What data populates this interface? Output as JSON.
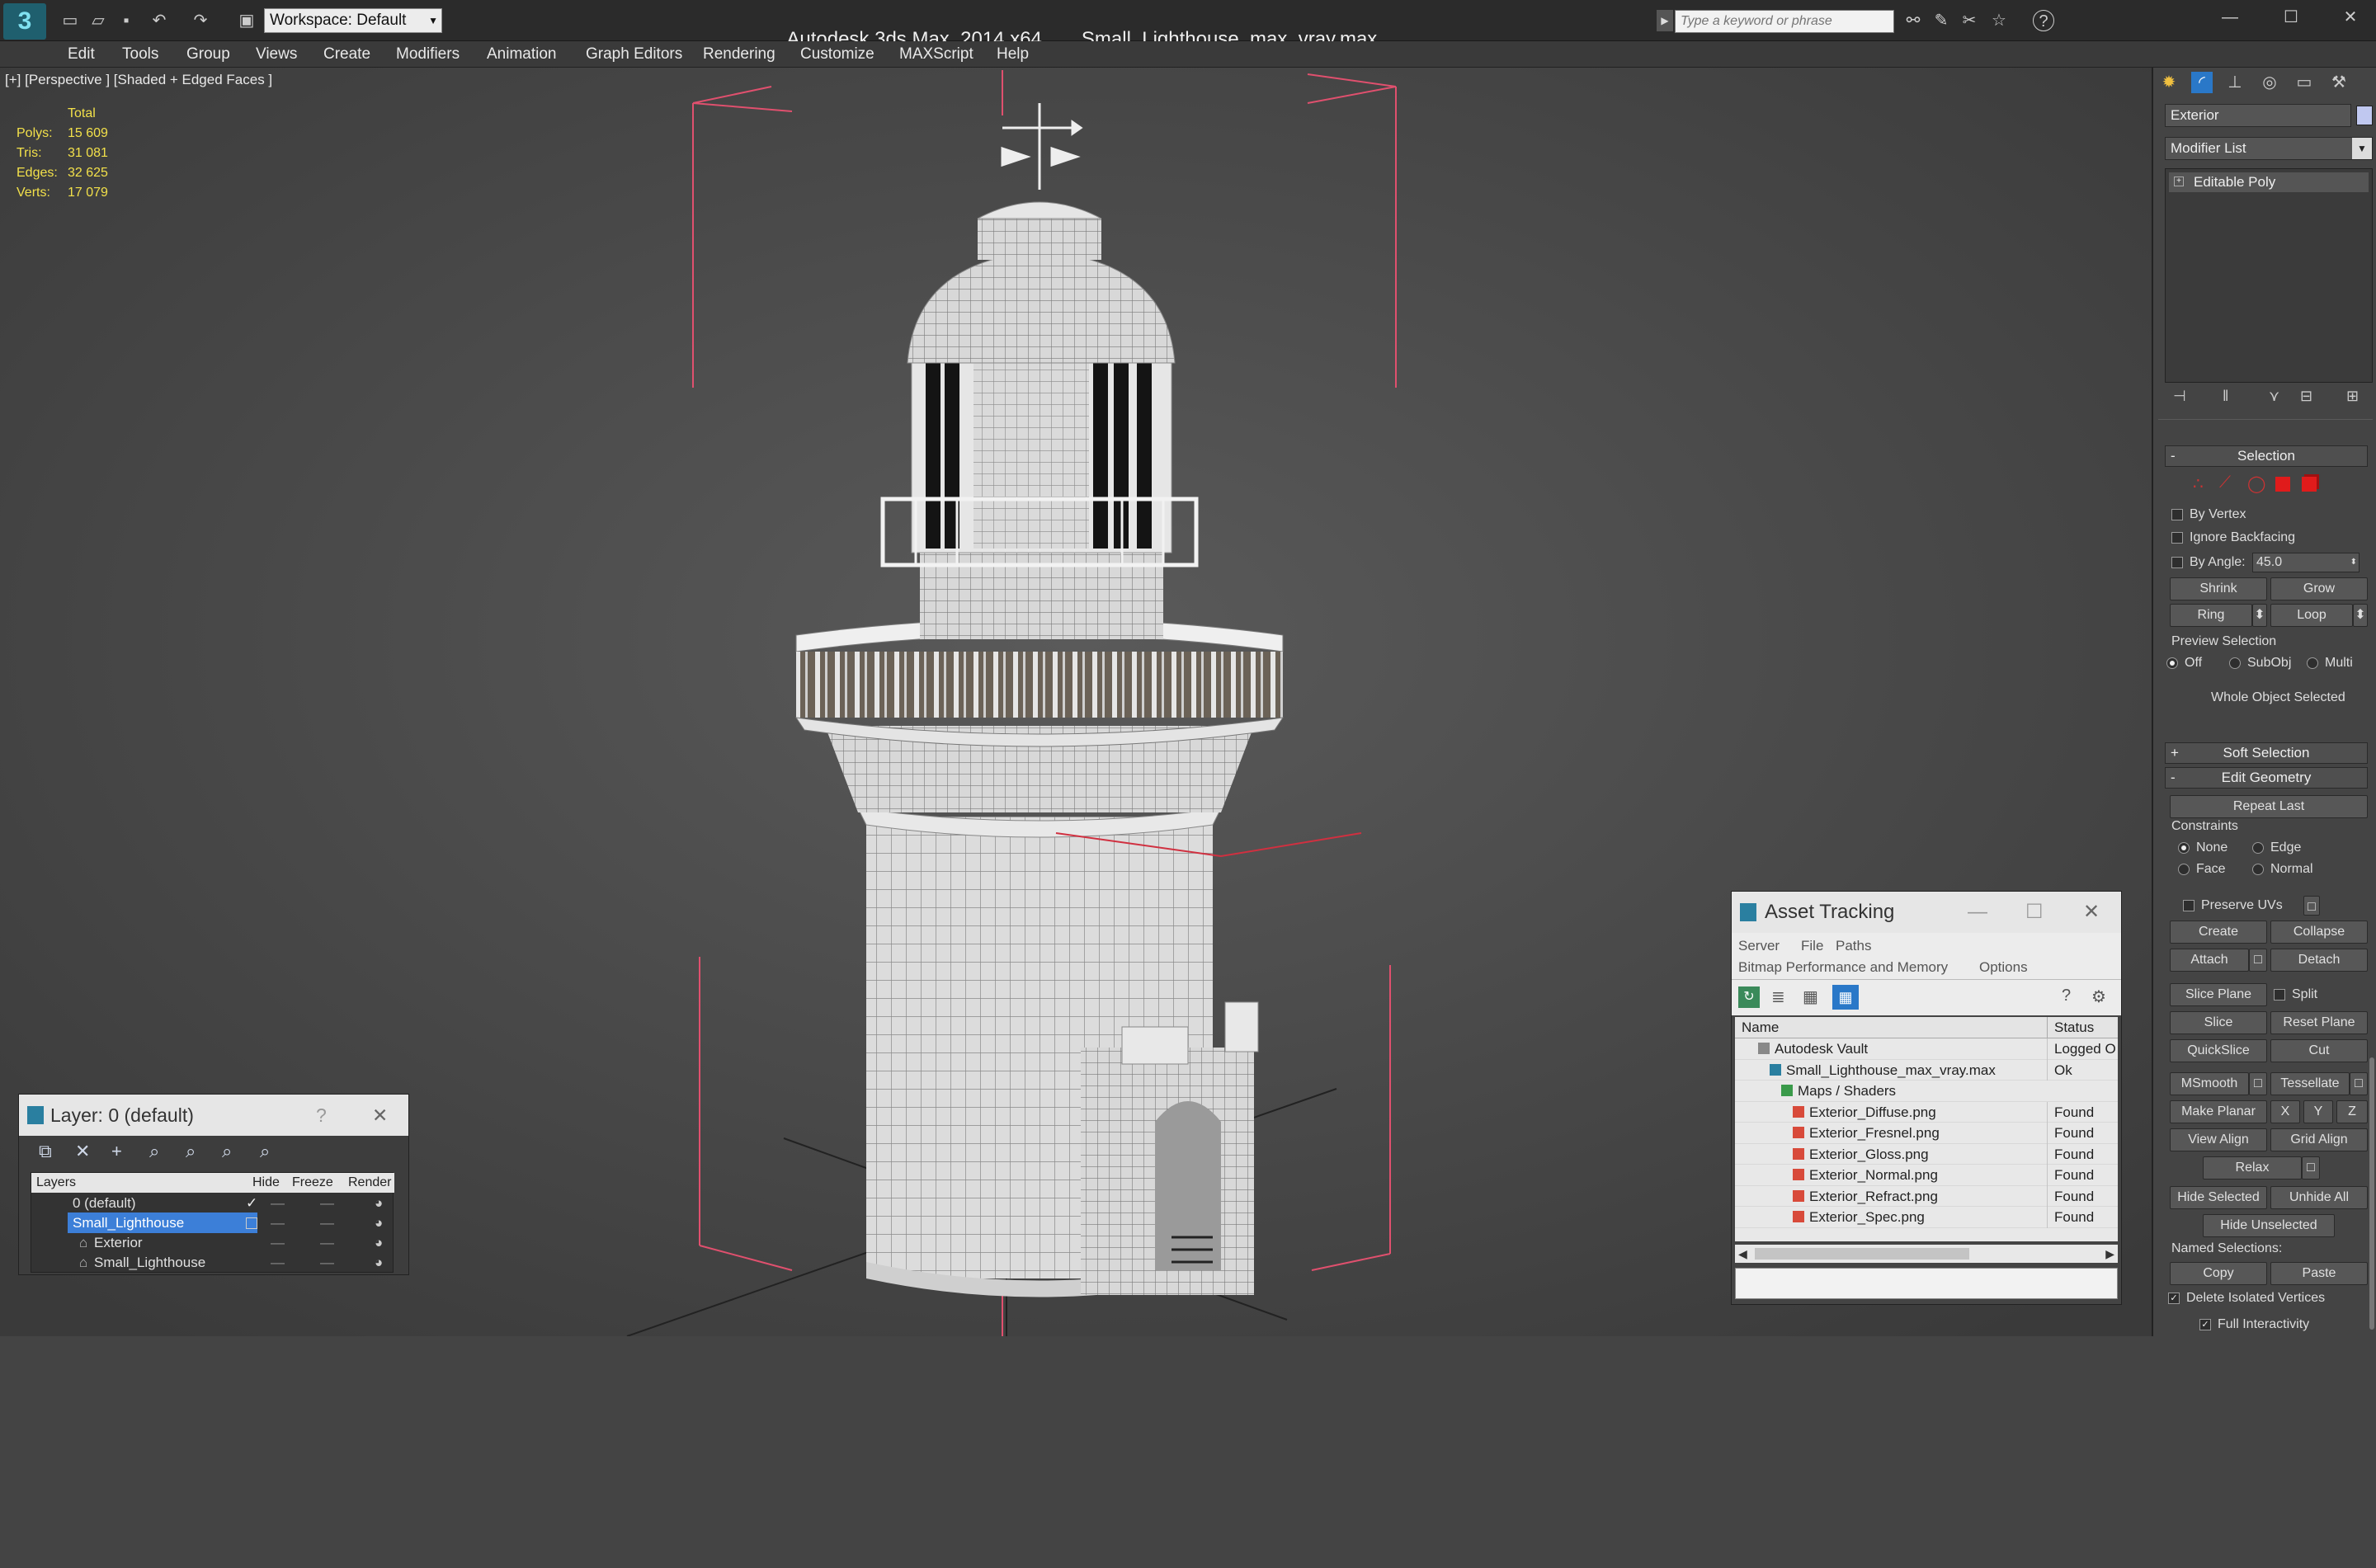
{
  "app": {
    "title": "Autodesk 3ds Max  2014 x64",
    "file": "Small_Lighthouse_max_vray.max",
    "workspace": "Workspace: Default",
    "search_placeholder": "Type a keyword or phrase"
  },
  "menu": [
    "Edit",
    "Tools",
    "Group",
    "Views",
    "Create",
    "Modifiers",
    "Animation",
    "Graph Editors",
    "Rendering",
    "Customize",
    "MAXScript",
    "Help"
  ],
  "viewport": {
    "label": "[+] [Perspective ] [Shaded + Edged Faces ]",
    "stats": {
      "total_label": "Total",
      "rows": [
        {
          "k": "Polys:",
          "v": "15 609"
        },
        {
          "k": "Tris:",
          "v": "31 081"
        },
        {
          "k": "Edges:",
          "v": "32 625"
        },
        {
          "k": "Verts:",
          "v": "17 079"
        }
      ]
    }
  },
  "layer_panel": {
    "title": "Layer: 0 (default)",
    "help": "?",
    "columns": [
      "Layers",
      "Hide",
      "Freeze",
      "Render"
    ],
    "rows": [
      {
        "name": "0 (default)",
        "indent": 1,
        "selected": false
      },
      {
        "name": "Small_Lighthouse",
        "indent": 1,
        "selected": true
      },
      {
        "name": "Exterior",
        "indent": 2,
        "selected": false
      },
      {
        "name": "Small_Lighthouse",
        "indent": 2,
        "selected": false
      }
    ]
  },
  "asset_panel": {
    "title": "Asset Tracking",
    "menu1": [
      "Server",
      "File",
      "Paths"
    ],
    "menu2": [
      "Bitmap Performance and Memory",
      "Options"
    ],
    "columns": [
      "Name",
      "Status"
    ],
    "rows": [
      {
        "name": "Autodesk Vault",
        "status": "Logged O",
        "indent": 1
      },
      {
        "name": "Small_Lighthouse_max_vray.max",
        "status": "Ok",
        "indent": 2
      },
      {
        "name": "Maps / Shaders",
        "status": "",
        "indent": 3
      },
      {
        "name": "Exterior_Diffuse.png",
        "status": "Found",
        "indent": 4
      },
      {
        "name": "Exterior_Fresnel.png",
        "status": "Found",
        "indent": 4
      },
      {
        "name": "Exterior_Gloss.png",
        "status": "Found",
        "indent": 4
      },
      {
        "name": "Exterior_Normal.png",
        "status": "Found",
        "indent": 4
      },
      {
        "name": "Exterior_Refract.png",
        "status": "Found",
        "indent": 4
      },
      {
        "name": "Exterior_Spec.png",
        "status": "Found",
        "indent": 4
      }
    ]
  },
  "cmd": {
    "object_name": "Exterior",
    "modifier_list": "Modifier List",
    "stack_item": "Editable Poly",
    "selection_title": "Selection",
    "by_vertex": "By Vertex",
    "ignore_backfacing": "Ignore Backfacing",
    "by_angle": "By Angle:",
    "angle_value": "45.0",
    "shrink": "Shrink",
    "grow": "Grow",
    "ring": "Ring",
    "loop": "Loop",
    "preview_selection": "Preview Selection",
    "off": "Off",
    "subobj": "SubObj",
    "multi": "Multi",
    "whole_object": "Whole Object Selected",
    "soft_selection": "Soft Selection",
    "edit_geometry": "Edit Geometry",
    "repeat_last": "Repeat Last",
    "constraints": "Constraints",
    "none": "None",
    "edge": "Edge",
    "face": "Face",
    "normal": "Normal",
    "preserve_uvs": "Preserve UVs",
    "create": "Create",
    "collapse": "Collapse",
    "attach": "Attach",
    "detach": "Detach",
    "slice_plane": "Slice Plane",
    "split": "Split",
    "slice": "Slice",
    "reset_plane": "Reset Plane",
    "quickslice": "QuickSlice",
    "cut": "Cut",
    "msmooth": "MSmooth",
    "tessellate": "Tessellate",
    "make_planar": "Make Planar",
    "x": "X",
    "y": "Y",
    "z": "Z",
    "view_align": "View Align",
    "grid_align": "Grid Align",
    "relax": "Relax",
    "hide_selected": "Hide Selected",
    "unhide_all": "Unhide All",
    "hide_unselected": "Hide Unselected",
    "named_selections": "Named Selections:",
    "copy": "Copy",
    "paste": "Paste",
    "delete_isolated": "Delete Isolated Vertices",
    "full_interactivity": "Full Interactivity"
  },
  "colors": {
    "accent": "#3c7fd8",
    "selection_red": "#e01b1b",
    "stats_yellow": "#f2e04a",
    "bbox_pink": "#e0506e"
  }
}
